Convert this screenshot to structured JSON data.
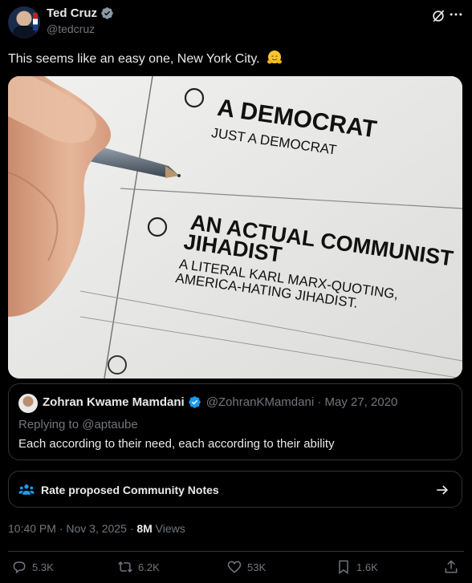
{
  "author": {
    "name": "Ted Cruz",
    "handle": "@tedcruz"
  },
  "tweet": {
    "text": "This seems like an easy one, New York City.",
    "emoji": "hugging-face-emoji"
  },
  "ballot_image": {
    "option1_title": "A DEMOCRAT",
    "option1_subtitle": "JUST A DEMOCRAT",
    "option2_title_line1": "AN ACTUAL COMMUNIST",
    "option2_title_line2": "JIHADIST",
    "option2_desc_line1": "A LITERAL KARL MARX-QUOTING,",
    "option2_desc_line2": "AMERICA-HATING JIHADIST."
  },
  "quote": {
    "name": "Zohran Kwame Mamdani",
    "meta": "@ZohranKMamdani · May 27, 2020",
    "replying": "Replying to @aptaube",
    "body": "Each according to their need, each according to their ability"
  },
  "community_notes": {
    "label": "Rate proposed Community Notes"
  },
  "timestamp": {
    "time_date": "10:40 PM · Nov 3, 2025 · ",
    "views": "8M",
    "views_label": " Views"
  },
  "actions": {
    "replies": "5.3K",
    "reposts": "6.2K",
    "likes": "53K",
    "bookmarks": "1.6K"
  },
  "colors": {
    "background": "#000000",
    "text": "#e7e9ea",
    "muted": "#71767b",
    "border": "#2f3336",
    "verified": "#1d9bf0"
  }
}
